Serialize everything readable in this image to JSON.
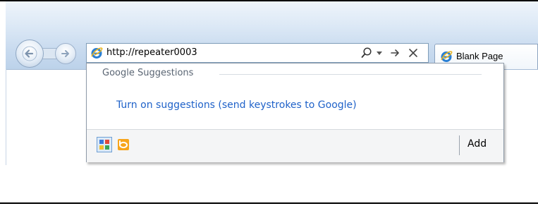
{
  "address_bar": {
    "url": "http://repeater0003",
    "icons": [
      "ie-icon",
      "search-icon",
      "chevron-down-icon",
      "go-arrow-icon",
      "stop-x-icon"
    ]
  },
  "navigation": {
    "back_icon": "back-arrow-icon",
    "forward_icon": "forward-arrow-icon"
  },
  "tab": {
    "label": "Blank Page",
    "icon": "ie-icon"
  },
  "suggestions_dropdown": {
    "section_title": "Google Suggestions",
    "enable_link": "Turn on suggestions (send keystrokes to Google)",
    "providers": [
      "google-provider-icon",
      "bing-provider-icon"
    ],
    "add_label": "Add"
  },
  "colors": {
    "link": "#1f62c9",
    "chrome_top": "#eef4fb",
    "chrome_bottom": "#bcd2ea",
    "address_border": "#7f9db9"
  }
}
